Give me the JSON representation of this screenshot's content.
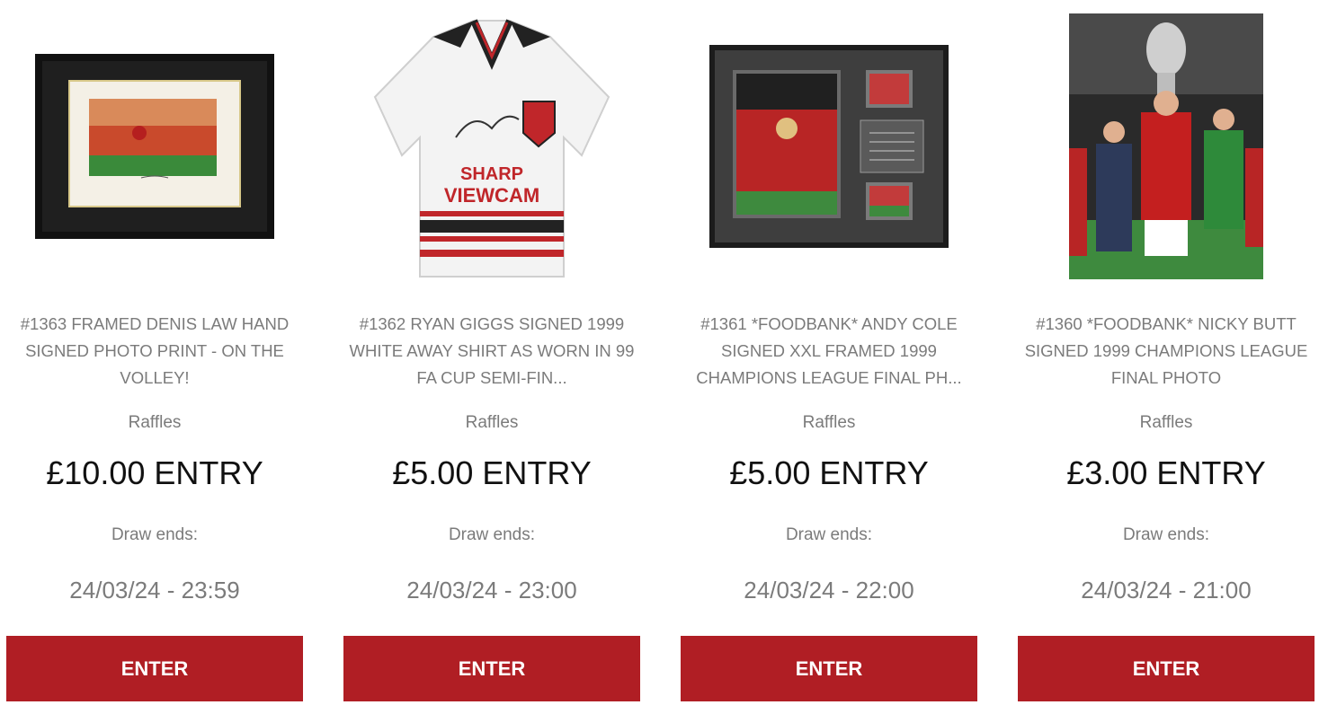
{
  "products": [
    {
      "title": "#1363 FRAMED DENIS LAW HAND SIGNED PHOTO PRINT - ON THE VOLLEY!",
      "category": "Raffles",
      "price": "£10.00 ENTRY",
      "draw_label": "Draw ends:",
      "draw_date": "24/03/24 - 23:59",
      "button_label": "ENTER"
    },
    {
      "title": "#1362 RYAN GIGGS SIGNED 1999 WHITE AWAY SHIRT AS WORN IN 99 FA CUP SEMI-FIN...",
      "category": "Raffles",
      "price": "£5.00 ENTRY",
      "draw_label": "Draw ends:",
      "draw_date": "24/03/24 - 23:00",
      "button_label": "ENTER",
      "shirt_text": [
        "SHARP",
        "VIEWCAM"
      ]
    },
    {
      "title": "#1361 *FOODBANK* ANDY COLE SIGNED XXL FRAMED 1999 CHAMPIONS LEAGUE FINAL PH...",
      "category": "Raffles",
      "price": "£5.00 ENTRY",
      "draw_label": "Draw ends:",
      "draw_date": "24/03/24 - 22:00",
      "button_label": "ENTER"
    },
    {
      "title": "#1360 *FOODBANK* NICKY BUTT SIGNED 1999 CHAMPIONS LEAGUE FINAL PHOTO",
      "category": "Raffles",
      "price": "£3.00 ENTRY",
      "draw_label": "Draw ends:",
      "draw_date": "24/03/24 - 21:00",
      "button_label": "ENTER"
    }
  ],
  "colors": {
    "button_bg": "#b01e24",
    "button_text": "#ffffff",
    "muted_text": "#7b7b7b",
    "price_text": "#111111"
  }
}
